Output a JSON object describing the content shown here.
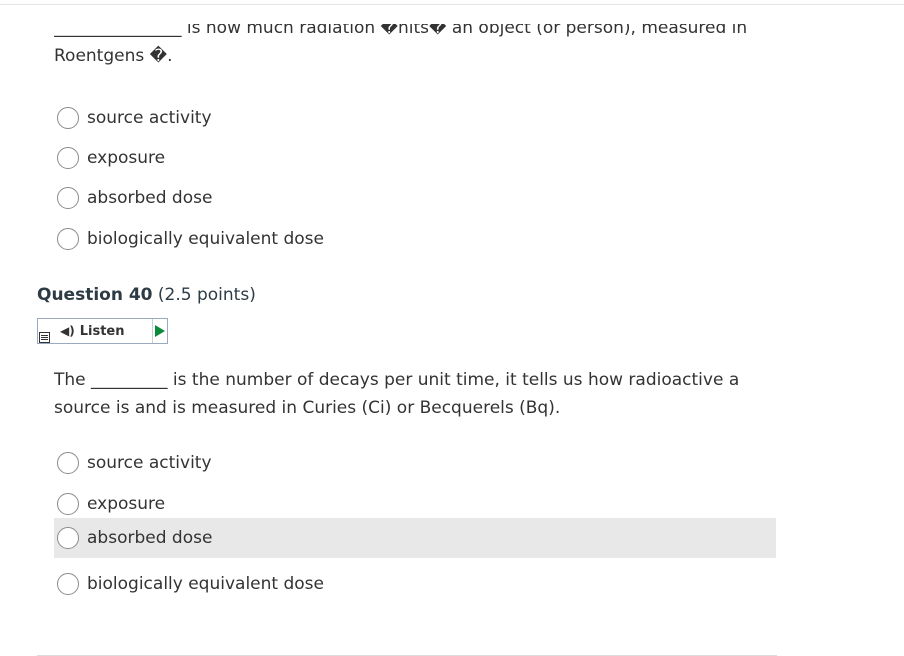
{
  "q39": {
    "text_line1": "_______________ is how much radiation �hits� an object (or person), measured in",
    "text_line2": "Roentgens �.",
    "options": [
      "source activity",
      "exposure",
      "absorbed dose",
      "biologically equivalent dose"
    ]
  },
  "q40": {
    "number_label": "Question 40",
    "points": "(2.5 points)",
    "listen_label": "Listen",
    "text_line1": "The _________ is the number of decays per unit time, it tells us how radioactive a",
    "text_line2": "source is and is measured in Curies (Ci) or Becquerels (Bq).",
    "options": [
      "source activity",
      "exposure",
      "absorbed dose",
      "biologically equivalent dose"
    ],
    "hovered_option": "absorbed dose"
  }
}
